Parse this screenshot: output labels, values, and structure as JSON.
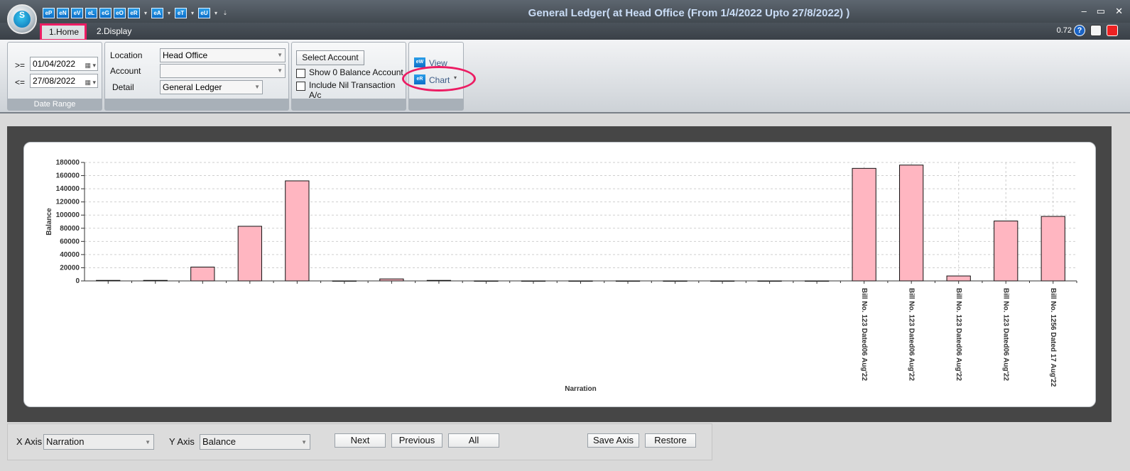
{
  "titlebar": {
    "logo_letter": "S",
    "quick_access": [
      {
        "label": "eP",
        "dropdown": false
      },
      {
        "label": "eN",
        "dropdown": false
      },
      {
        "label": "eV",
        "dropdown": false
      },
      {
        "label": "eL",
        "dropdown": false
      },
      {
        "label": "eG",
        "dropdown": false
      },
      {
        "label": "eO",
        "dropdown": false
      },
      {
        "label": "eR",
        "dropdown": true
      },
      {
        "label": "eA",
        "dropdown": true
      },
      {
        "label": "eT",
        "dropdown": true
      },
      {
        "label": "eU",
        "dropdown": true
      }
    ],
    "title": "General Ledger( at Head Office  (From 1/4/2022 Upto 27/8/2022) )",
    "minimize": "–",
    "maximize": "▭",
    "close": "✕"
  },
  "tabs": [
    {
      "label": "1.Home",
      "active": true
    },
    {
      "label": "2.Display",
      "active": false
    }
  ],
  "zoom": "0.72",
  "ribbon": {
    "date_range": {
      "ge_label": ">=",
      "le_label": "<=",
      "from": "01/04/2022",
      "to": "27/08/2022",
      "group_label": "Date Range"
    },
    "filters": {
      "location_label": "Location",
      "location_value": "Head Office",
      "account_label": "Account",
      "account_value": "",
      "detail_label": "Detail",
      "detail_value": "General Ledger"
    },
    "options": {
      "select_account": "Select Account",
      "show_zero": "Show 0 Balance Account",
      "include_nil": "Include Nil Transaction A/c"
    },
    "view_group": {
      "view_icon": "eW",
      "view_label": "View",
      "chart_icon": "eR",
      "chart_label": "Chart"
    }
  },
  "chart_data": {
    "type": "bar",
    "xlabel": "Narration",
    "ylabel": "Balance",
    "ylim": [
      0,
      180000
    ],
    "yticks": [
      0,
      20000,
      40000,
      60000,
      80000,
      100000,
      120000,
      140000,
      160000,
      180000
    ],
    "grid": true,
    "bar_color": "#ffb6c1",
    "categories": [
      "",
      "",
      "",
      "",
      "",
      "",
      "",
      "",
      "",
      "",
      "",
      "",
      "",
      "",
      "",
      "",
      "Bill No. 123 Dated06 Aug'22",
      "Bill No. 123 Dated06 Aug'22",
      "Bill No. 123 Dated06 Aug'22",
      "Bill No. 123 Dated06 Aug'22",
      "Bill No. 1256 Dated 17 Aug'22"
    ],
    "values": [
      800,
      800,
      21000,
      83000,
      152000,
      0,
      3000,
      800,
      0,
      0,
      0,
      0,
      0,
      0,
      0,
      0,
      171000,
      176000,
      7500,
      91000,
      98000
    ]
  },
  "bottombar": {
    "x_axis_label": "X Axis",
    "x_axis_value": "Narration",
    "y_axis_label": "Y Axis",
    "y_axis_value": "Balance",
    "next": "Next",
    "previous": "Previous",
    "all": "All",
    "save_axis": "Save Axis",
    "restore": "Restore"
  }
}
